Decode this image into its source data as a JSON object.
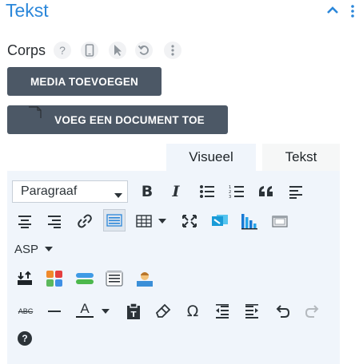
{
  "header": {
    "title": "Tekst"
  },
  "field": {
    "label": "Corps",
    "help_glyph": "?"
  },
  "buttons": {
    "add_media": "MEDIA TOEVOEGEN",
    "add_document": "VOEG EEN DOCUMENT TOE"
  },
  "tabs": {
    "visual": "Visueel",
    "text": "Tekst"
  },
  "toolbar": {
    "format_select": "Paragraaf",
    "asp_label": "ASP",
    "bold": "B",
    "italic": "I",
    "quote": "66",
    "underline": "A",
    "omega": "Ω",
    "strike": "ABC",
    "help": "?"
  },
  "colors": {
    "accent": "#2b87da",
    "button": "#4c5866",
    "editor_bg": "#f0f5fb"
  }
}
